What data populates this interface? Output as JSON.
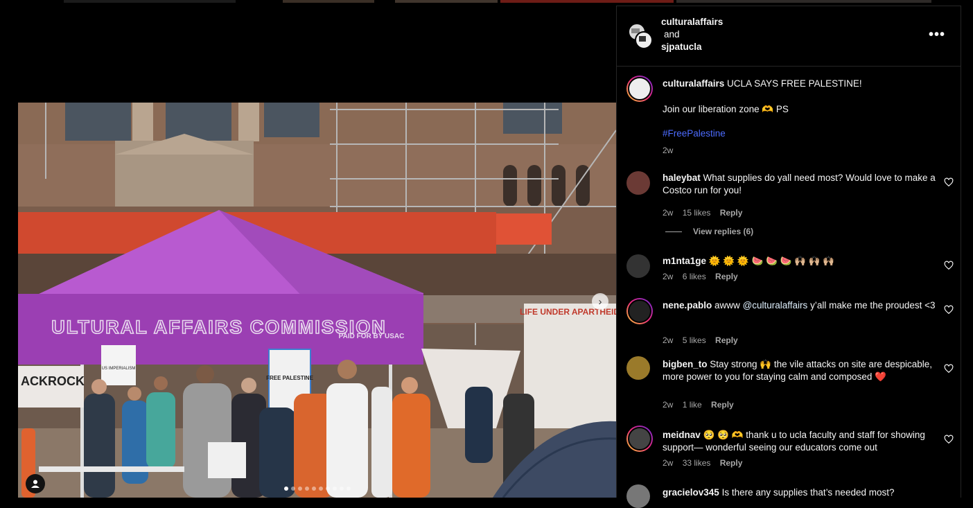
{
  "post": {
    "header": {
      "author1": "culturalaffairs",
      "and_text": "and",
      "author2": "sjpatucla",
      "more_label": "•••"
    },
    "caption": {
      "username": "culturalaffairs",
      "line1": "UCLA SAYS FREE PALESTINE!",
      "line2": "Join our liberation zone 🫶 PS",
      "hashtag": "#FreePalestine",
      "time": "2w"
    },
    "image": {
      "canopy_text": "ULTURAL AFFAIRS COMMISSION",
      "canopy_subtext": "PAID FOR BY USAC",
      "sign1": "LIFE UNDER APARTHEID",
      "sign2": "FREE PALESTINE",
      "sign3": "ACKROCK",
      "sign4": "US IMPERIALISM",
      "next_label": "›",
      "carousel_count": 10,
      "carousel_active": 0
    },
    "view_replies": "View replies (6)"
  },
  "comments": [
    {
      "username": "haleybat",
      "text": "What supplies do yall need most? Would love to make a Costco run for you!",
      "time": "2w",
      "likes": "15 likes",
      "reply": "Reply"
    },
    {
      "username": "m1nta1ge",
      "text": "🌞 🌞 🌞 🍉 🍉 🍉 🙌🏼 🙌🏼 🙌🏼",
      "time": "2w",
      "likes": "6 likes",
      "reply": "Reply"
    },
    {
      "username": "nene.pablo",
      "text_pre": "awww",
      "mention": "@culturalaffairs",
      "text_post": "y’all make me the proudest <3",
      "time": "2w",
      "likes": "5 likes",
      "reply": "Reply"
    },
    {
      "username": "bigben_to",
      "text": "Stay strong 🙌 the vile attacks on site are despicable, more power to you for staying calm and composed ❤️",
      "time": "2w",
      "likes": "1 like",
      "reply": "Reply"
    },
    {
      "username": "meidnav",
      "text": "🥺 🥺 🫶 thank u to ucla faculty and staff for showing support— wonderful seeing our educators come out",
      "time": "2w",
      "likes": "33 likes",
      "reply": "Reply"
    },
    {
      "username": "gracielov345",
      "text": "Is there any supplies that’s needed most?"
    }
  ],
  "colors": {
    "background": "#000000",
    "hashtag": "#4d6cff",
    "canopy": "#9b3fb3",
    "secondary_text": "#a8a8a8"
  },
  "icons": [
    "more-icon",
    "heart-icon",
    "chevron-right-icon",
    "user-tag-icon"
  ]
}
